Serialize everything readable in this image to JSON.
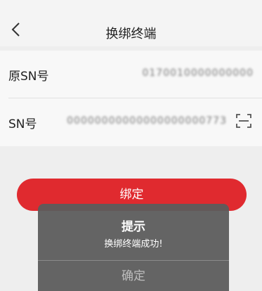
{
  "nav": {
    "title": "换绑终端"
  },
  "form": {
    "original_sn": {
      "label": "原SN号",
      "value": "0170010000000000"
    },
    "sn": {
      "label": "SN号",
      "value": "00000000000000000000773"
    }
  },
  "bind_button": {
    "label": "绑定"
  },
  "dialog": {
    "title": "提示",
    "message": "换绑终端成功!",
    "confirm_label": "确定"
  },
  "colors": {
    "accent": "#e02a2f",
    "dialog_bg": "#5c5c5c"
  },
  "icons": {
    "back": "chevron-left-icon",
    "scan": "scan-icon"
  }
}
